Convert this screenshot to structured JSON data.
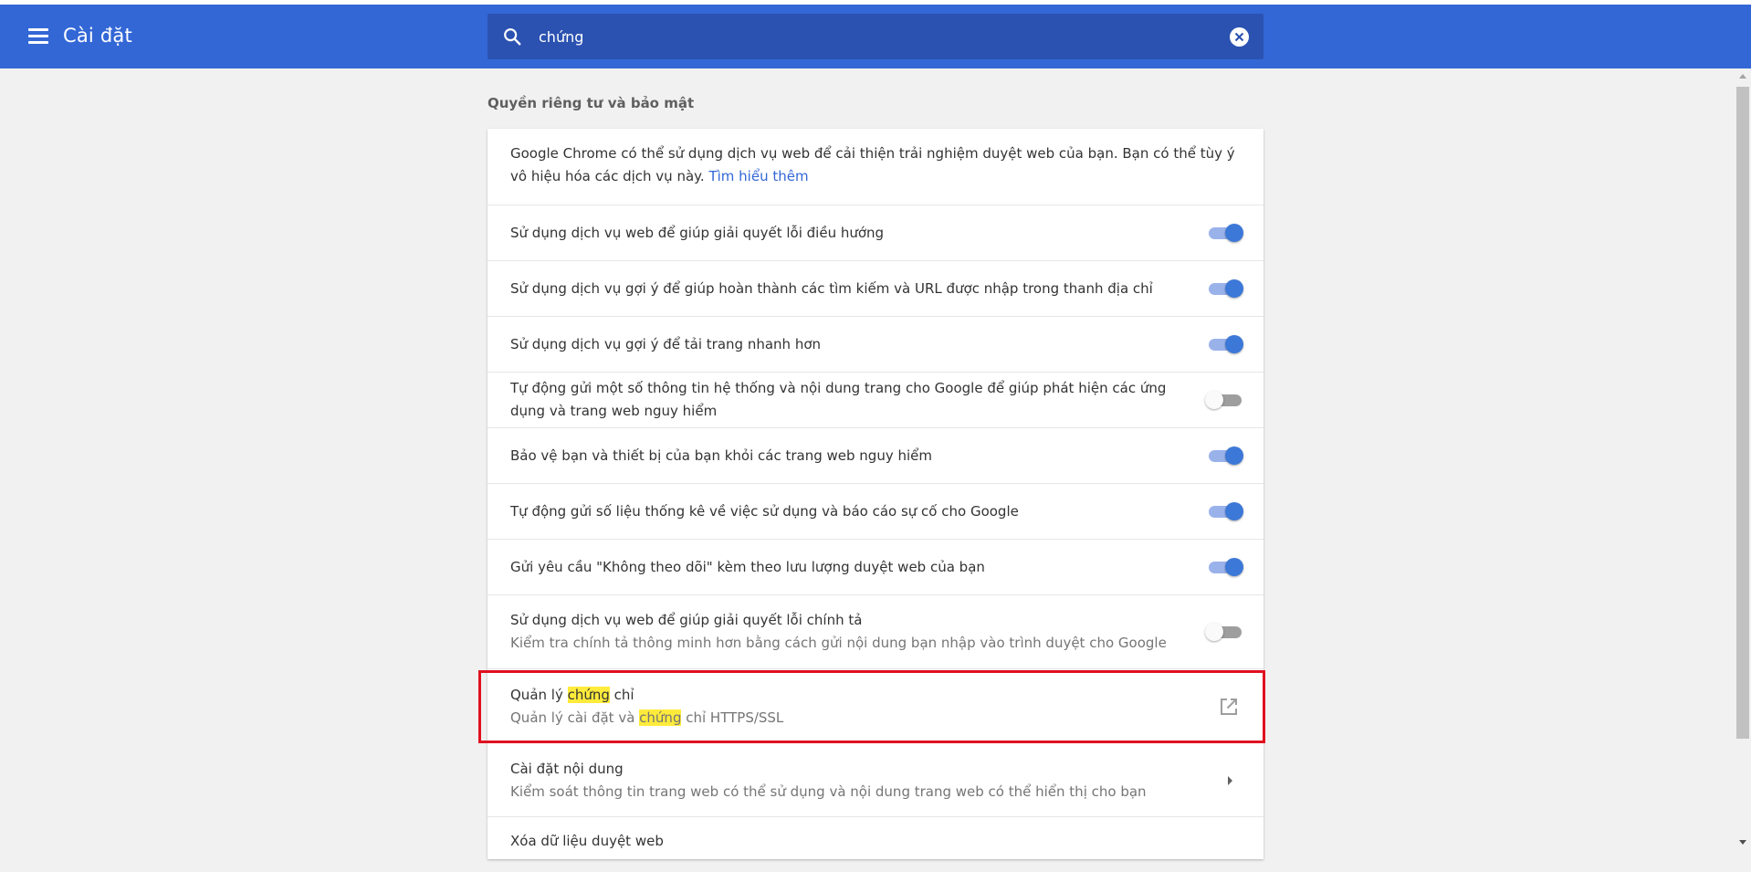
{
  "header": {
    "title": "Cài đặt",
    "search_value": "chứng"
  },
  "section": {
    "title": "Quyền riêng tư và bảo mật"
  },
  "intro": {
    "text": "Google Chrome có thể sử dụng dịch vụ web để cải thiện trải nghiệm duyệt web của bạn. Bạn có thể tùy ý vô hiệu hóa các dịch vụ này.",
    "link": "Tìm hiểu thêm"
  },
  "toggles": [
    {
      "label": "Sử dụng dịch vụ web để giúp giải quyết lỗi điều hướng",
      "on": true
    },
    {
      "label": "Sử dụng dịch vụ gợi ý để giúp hoàn thành các tìm kiếm và URL được nhập trong thanh địa chỉ",
      "on": true
    },
    {
      "label": "Sử dụng dịch vụ gợi ý để tải trang nhanh hơn",
      "on": true
    },
    {
      "label": "Tự động gửi một số thông tin hệ thống và nội dung trang cho Google để giúp phát hiện các ứng dụng và trang web nguy hiểm",
      "on": false
    },
    {
      "label": "Bảo vệ bạn và thiết bị của bạn khỏi các trang web nguy hiểm",
      "on": true
    },
    {
      "label": "Tự động gửi số liệu thống kê về việc sử dụng và báo cáo sự cố cho Google",
      "on": true
    },
    {
      "label": "Gửi yêu cầu \"Không theo dõi\" kèm theo lưu lượng duyệt web của bạn",
      "on": true
    },
    {
      "label": "Sử dụng dịch vụ web để giúp giải quyết lỗi chính tả",
      "sub": "Kiểm tra chính tả thông minh hơn bằng cách gửi nội dung bạn nhập vào trình duyệt cho Google",
      "on": false
    }
  ],
  "certificates": {
    "title_before": "Quản lý ",
    "title_highlight": "chứng",
    "title_after": " chỉ",
    "sub_before": "Quản lý cài đặt và ",
    "sub_highlight": "chứng",
    "sub_after": " chỉ HTTPS/SSL"
  },
  "content_settings": {
    "title": "Cài đặt nội dung",
    "sub": "Kiểm soát thông tin trang web có thể sử dụng và nội dung trang web có thể hiển thị cho bạn"
  },
  "clear_data": {
    "title": "Xóa dữ liệu duyệt web"
  },
  "colors": {
    "header": "#3367d6",
    "toggle_on": "#3c78d8",
    "highlight": "#ffeb3b",
    "annotation": "#e0101f"
  },
  "icons": [
    "menu-icon",
    "search-icon",
    "clear-icon",
    "open-in-new-icon",
    "chevron-right-icon"
  ]
}
